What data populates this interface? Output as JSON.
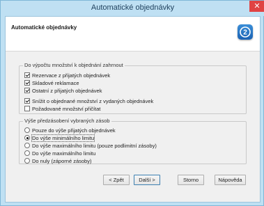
{
  "window": {
    "title": "Automatické objednávky",
    "close_symbol": "✕"
  },
  "header": {
    "title": "Automatické objednávky",
    "icon": "wizard-icon"
  },
  "group_calc": {
    "title": "Do výpočtu množství k objednání zahrnout",
    "options": [
      {
        "label": "Rezervace z přijatých objednávek",
        "checked": true
      },
      {
        "label": "Skladové reklamace",
        "checked": true
      },
      {
        "label": "Ostatní z přijatých objednávek",
        "checked": true
      },
      {
        "label": "Snížit o objednané množství z vydaných objednávek",
        "checked": true
      },
      {
        "label": "Požadované množství přičítat",
        "checked": false
      }
    ]
  },
  "group_prestock": {
    "title": "Výše předzásobení vybraných zásob",
    "options": [
      {
        "label": "Pouze do výše přijatých objednávek",
        "selected": false
      },
      {
        "label": "Do výše minimálního limitu",
        "selected": true
      },
      {
        "label": "Do výše maximálního limitu (pouze podlimitní zásoby)",
        "selected": false
      },
      {
        "label": "Do výše maximálního limitu",
        "selected": false
      },
      {
        "label": "Do nuly (záporné zásoby)",
        "selected": false
      }
    ]
  },
  "buttons": {
    "back_label": "< Zpět",
    "next_label": "Další >",
    "cancel_label": "Storno",
    "help_label": "Nápověda"
  }
}
